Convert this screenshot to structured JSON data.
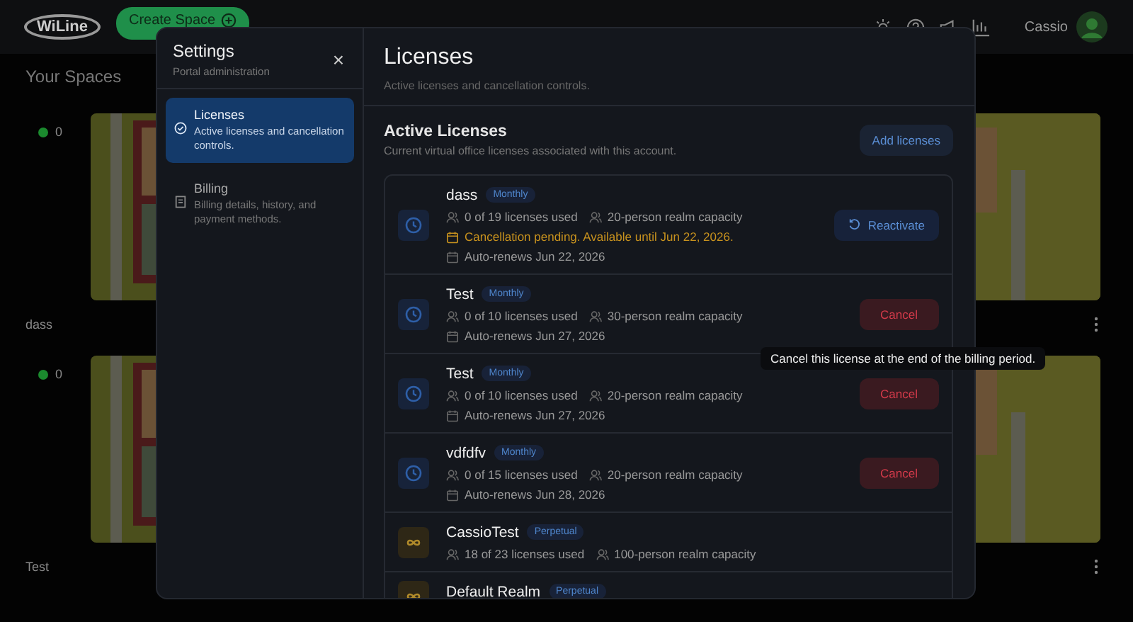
{
  "header": {
    "logo": "WiLine",
    "create_button": "Create Space",
    "user_name": "Cassio"
  },
  "page_title": "Your Spaces",
  "spaces": [
    {
      "name": "dass",
      "online_count": "0",
      "kind": "picture"
    },
    {
      "name": "Test",
      "online_count": "0",
      "kind": "picture"
    }
  ],
  "settings": {
    "title": "Settings",
    "subtitle": "Portal administration",
    "close": "×",
    "nav": [
      {
        "label": "Licenses",
        "description": "Active licenses and cancellation controls.",
        "selected": true
      },
      {
        "label": "Billing",
        "description": "Billing details, history, and payment methods.",
        "selected": false
      }
    ]
  },
  "content": {
    "title": "Licenses",
    "subtitle": "Active licenses and cancellation controls.",
    "section_title": "Active Licenses",
    "section_subtitle": "Current virtual office licenses associated with this account.",
    "add_button": "Add licenses",
    "licenses": [
      {
        "name": "dass",
        "plan": "Monthly",
        "kind": "monthly",
        "usage": "0 of 19 licenses used",
        "capacity": "20-person realm capacity",
        "notice": "Cancellation pending. Available until Jun 22, 2026.",
        "renewal": "Auto-renews Jun 22, 2026",
        "action": {
          "label": "Reactivate",
          "kind": "reactivate"
        }
      },
      {
        "name": "Test",
        "plan": "Monthly",
        "kind": "monthly",
        "usage": "0 of 10 licenses used",
        "capacity": "30-person realm capacity",
        "renewal": "Auto-renews Jun 27, 2026",
        "action": {
          "label": "Cancel",
          "kind": "cancel"
        }
      },
      {
        "name": "Test",
        "plan": "Monthly",
        "kind": "monthly",
        "usage": "0 of 10 licenses used",
        "capacity": "20-person realm capacity",
        "renewal": "Auto-renews Jun 27, 2026",
        "action": {
          "label": "Cancel",
          "kind": "cancel"
        }
      },
      {
        "name": "vdfdfv",
        "plan": "Monthly",
        "kind": "monthly",
        "usage": "0 of 15 licenses used",
        "capacity": "20-person realm capacity",
        "renewal": "Auto-renews Jun 28, 2026",
        "action": {
          "label": "Cancel",
          "kind": "cancel"
        }
      },
      {
        "name": "CassioTest",
        "plan": "Perpetual",
        "kind": "perpetual",
        "usage": "18 of 23 licenses used",
        "capacity": "100-person realm capacity"
      },
      {
        "name": "Default Realm",
        "plan": "Perpetual",
        "kind": "perpetual"
      }
    ]
  },
  "tooltip": "Cancel this license at the end of the billing period."
}
